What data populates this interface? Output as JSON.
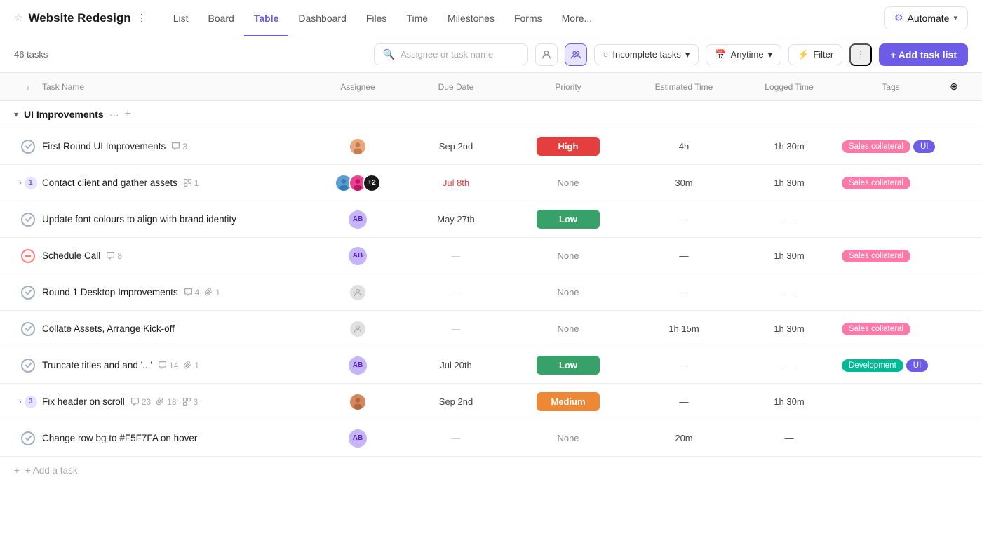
{
  "header": {
    "star_icon": "★",
    "project_title": "Website Redesign",
    "more_dots": "⋮",
    "nav_tabs": [
      {
        "label": "List",
        "active": false
      },
      {
        "label": "Board",
        "active": false
      },
      {
        "label": "Table",
        "active": true
      },
      {
        "label": "Dashboard",
        "active": false
      },
      {
        "label": "Files",
        "active": false
      },
      {
        "label": "Time",
        "active": false
      },
      {
        "label": "Milestones",
        "active": false
      },
      {
        "label": "Forms",
        "active": false
      },
      {
        "label": "More...",
        "active": false
      }
    ],
    "automate_label": "Automate",
    "automate_chevron": "▾"
  },
  "toolbar": {
    "task_count": "46 tasks",
    "search_placeholder": "Assignee or task name",
    "group_label": "Incomplete tasks",
    "group_chevron": "▾",
    "time_label": "Anytime",
    "time_chevron": "▾",
    "filter_label": "Filter",
    "kebab": "⋮",
    "add_task_list_label": "+ Add task list"
  },
  "table": {
    "columns": [
      "",
      "Task Name",
      "Assignee",
      "Due Date",
      "Priority",
      "Estimated Time",
      "Logged Time",
      "Tags",
      ""
    ],
    "section": {
      "title": "UI Improvements",
      "dots": "···",
      "plus": "+"
    },
    "rows": [
      {
        "id": "r1",
        "status": "done",
        "name": "First Round UI Improvements",
        "comments": 3,
        "clips": null,
        "subtasks": null,
        "assignee_type": "photo1",
        "due_date": "Sep 2nd",
        "due_overdue": false,
        "priority": "High",
        "priority_type": "high",
        "est_time": "4h",
        "logged_time": "1h 30m",
        "tags": [
          "Sales collateral",
          "UI"
        ]
      },
      {
        "id": "r2",
        "status": "expand",
        "expand_count": "1",
        "name": "Contact client and gather assets",
        "comments": null,
        "clips": null,
        "subtasks": 1,
        "subtask_icon": "⊣",
        "assignee_type": "multi",
        "due_date": "Jul 8th",
        "due_overdue": true,
        "priority": "None",
        "priority_type": "none",
        "est_time": "30m",
        "logged_time": "1h 30m",
        "tags": [
          "Sales collateral"
        ]
      },
      {
        "id": "r3",
        "status": "done",
        "name": "Update font colours to align with brand identity",
        "comments": null,
        "clips": null,
        "subtasks": null,
        "assignee_type": "ab",
        "due_date": "May 27th",
        "due_overdue": false,
        "priority": "Low",
        "priority_type": "low",
        "est_time": "—",
        "logged_time": "—",
        "tags": []
      },
      {
        "id": "r4",
        "status": "blocked",
        "name": "Schedule Call",
        "comments": 8,
        "clips": null,
        "subtasks": null,
        "assignee_type": "ab",
        "due_date": "—",
        "due_overdue": false,
        "priority": "None",
        "priority_type": "none",
        "est_time": "—",
        "logged_time": "1h 30m",
        "tags": [
          "Sales collateral"
        ]
      },
      {
        "id": "r5",
        "status": "done",
        "name": "Round 1 Desktop Improvements",
        "comments": 4,
        "clips": 1,
        "subtasks": null,
        "assignee_type": "placeholder",
        "due_date": "—",
        "due_overdue": false,
        "priority": "None",
        "priority_type": "none",
        "est_time": "—",
        "logged_time": "—",
        "tags": []
      },
      {
        "id": "r6",
        "status": "done",
        "name": "Collate Assets, Arrange Kick-off",
        "comments": null,
        "clips": null,
        "subtasks": null,
        "assignee_type": "placeholder",
        "due_date": "—",
        "due_overdue": false,
        "priority": "None",
        "priority_type": "none",
        "est_time": "1h 15m",
        "logged_time": "1h 30m",
        "tags": [
          "Sales collateral"
        ]
      },
      {
        "id": "r7",
        "status": "done",
        "name": "Truncate titles and and '...'",
        "comments": 14,
        "clips": 1,
        "subtasks": null,
        "assignee_type": "ab",
        "due_date": "Jul 20th",
        "due_overdue": false,
        "priority": "Low",
        "priority_type": "low",
        "est_time": "—",
        "logged_time": "—",
        "tags": [
          "Development",
          "UI"
        ]
      },
      {
        "id": "r8",
        "status": "expand",
        "expand_count": "3",
        "name": "Fix header on scroll",
        "comments": 23,
        "clips": 18,
        "subtasks": 3,
        "assignee_type": "photo2",
        "due_date": "Sep 2nd",
        "due_overdue": false,
        "priority": "Medium",
        "priority_type": "medium",
        "est_time": "—",
        "logged_time": "1h 30m",
        "tags": []
      },
      {
        "id": "r9",
        "status": "done",
        "name": "Change row bg to #F5F7FA on hover",
        "comments": null,
        "clips": null,
        "subtasks": null,
        "assignee_type": "ab",
        "due_date": "—",
        "due_overdue": false,
        "priority": "None",
        "priority_type": "none",
        "est_time": "20m",
        "logged_time": "—",
        "tags": []
      }
    ],
    "add_task_label": "+ Add a task"
  }
}
